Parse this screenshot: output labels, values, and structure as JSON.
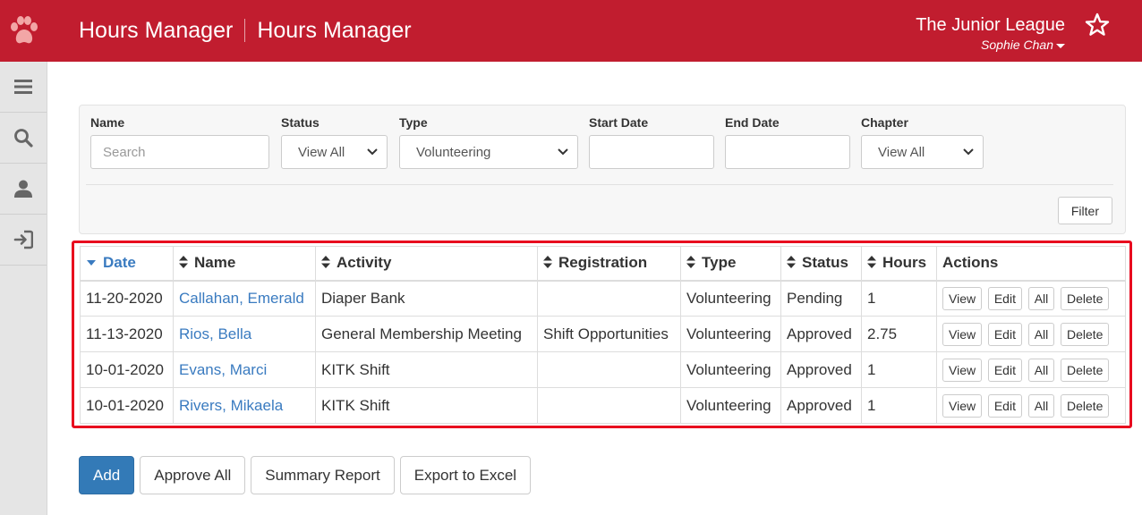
{
  "header": {
    "title_primary": "Hours Manager",
    "title_secondary": "Hours Manager",
    "org_name": "The Junior League",
    "user_name": "Sophie Chan",
    "brand_color": "#c11d2f",
    "icons": [
      "paw-icon",
      "star-icon"
    ]
  },
  "sidebar": {
    "items": [
      {
        "icon": "menu-icon"
      },
      {
        "icon": "search-icon"
      },
      {
        "icon": "user-icon"
      },
      {
        "icon": "sign-out-icon"
      }
    ]
  },
  "filters": {
    "name_label": "Name",
    "name_placeholder": "Search",
    "status_label": "Status",
    "status_value": "View All",
    "type_label": "Type",
    "type_value": "Volunteering",
    "start_date_label": "Start Date",
    "start_date_value": "",
    "end_date_label": "End Date",
    "end_date_value": "",
    "chapter_label": "Chapter",
    "chapter_value": "View All",
    "filter_button": "Filter"
  },
  "table": {
    "columns": [
      "Date",
      "Name",
      "Activity",
      "Registration",
      "Type",
      "Status",
      "Hours",
      "Actions"
    ],
    "sorted_column": "Date",
    "action_labels": [
      "View",
      "Edit",
      "All",
      "Delete"
    ],
    "rows": [
      {
        "date": "11-20-2020",
        "name": "Callahan, Emerald",
        "activity": "Diaper Bank",
        "registration": "",
        "type": "Volunteering",
        "status": "Pending",
        "hours": "1"
      },
      {
        "date": "11-13-2020",
        "name": "Rios, Bella",
        "activity": "General Membership Meeting",
        "registration": "Shift Opportunities",
        "type": "Volunteering",
        "status": "Approved",
        "hours": "2.75"
      },
      {
        "date": "10-01-2020",
        "name": "Evans, Marci",
        "activity": "KITK Shift",
        "registration": "",
        "type": "Volunteering",
        "status": "Approved",
        "hours": "1"
      },
      {
        "date": "10-01-2020",
        "name": "Rivers, Mikaela",
        "activity": "KITK Shift",
        "registration": "",
        "type": "Volunteering",
        "status": "Approved",
        "hours": "1"
      }
    ]
  },
  "bottom": {
    "add": "Add",
    "approve_all": "Approve All",
    "summary_report": "Summary Report",
    "export": "Export to Excel"
  }
}
